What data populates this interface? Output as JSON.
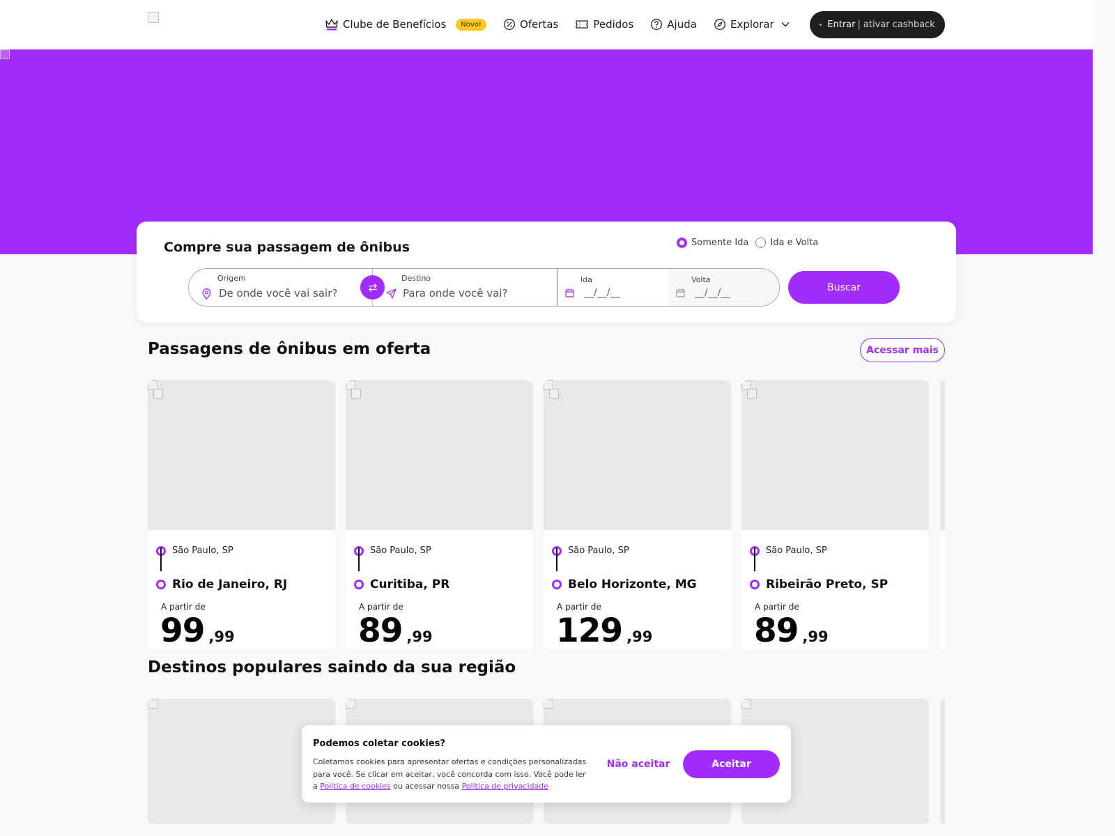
{
  "header": {
    "nav": {
      "club": "Clube de Benefícios",
      "club_badge": "Novo!",
      "offers": "Ofertas",
      "orders": "Pedidos",
      "help": "Ajuda",
      "explore": "Explorar"
    },
    "login_label": "Entrar",
    "login_separator": "|",
    "cashback_label": "ativar cashback"
  },
  "search": {
    "title": "Compre sua passagem de ônibus",
    "trip_options": [
      "Somente Ida",
      "Ida e Volta"
    ],
    "selected_trip": "Somente Ida",
    "origin_label": "Origem",
    "origin_placeholder": "De onde você vai sair?",
    "destination_label": "Destino",
    "destination_placeholder": "Para onde você vai?",
    "departure_label": "Ida",
    "departure_value": "__/__/__",
    "return_label": "Volta",
    "return_value": "__/__/__",
    "search_button": "Buscar"
  },
  "offers": {
    "title": "Passagens de ônibus em oferta",
    "more_button": "Acessar mais",
    "price_prefix": "A partir de",
    "cards": [
      {
        "origin": "São Paulo, SP",
        "destination": "Rio de Janeiro, RJ",
        "price_int": "99",
        "price_cents": ",99"
      },
      {
        "origin": "São Paulo, SP",
        "destination": "Curitiba, PR",
        "price_int": "89",
        "price_cents": ",99"
      },
      {
        "origin": "São Paulo, SP",
        "destination": "Belo Horizonte, MG",
        "price_int": "129",
        "price_cents": ",99"
      },
      {
        "origin": "São Paulo, SP",
        "destination": "Ribeirão Preto, SP",
        "price_int": "89",
        "price_cents": ",99"
      }
    ]
  },
  "popular": {
    "title": "Destinos populares saindo da sua região"
  },
  "cookie": {
    "title": "Podemos coletar cookies?",
    "text": "Coletamos cookies para apresentar ofertas e condições personalizadas para você. Se clicar em aceitar, você concorda com isso. Você pode ler a",
    "cookie_policy_link": "Política de cookies",
    "middle_text": "ou acessar nossa",
    "privacy_policy_link": "Política de privacidade",
    "reject_button": "Não aceitar",
    "accept_button": "Aceitar"
  },
  "colors": {
    "brand": "#a22bfe",
    "badge": "#ffc81e",
    "dark_button": "#1e1e1e"
  },
  "icons": [
    "crown-icon",
    "discount-icon",
    "ticket-icon",
    "help-icon",
    "compass-icon",
    "chevron-down-icon",
    "location-pin-icon",
    "swap-icon",
    "send-icon",
    "calendar-icon"
  ]
}
